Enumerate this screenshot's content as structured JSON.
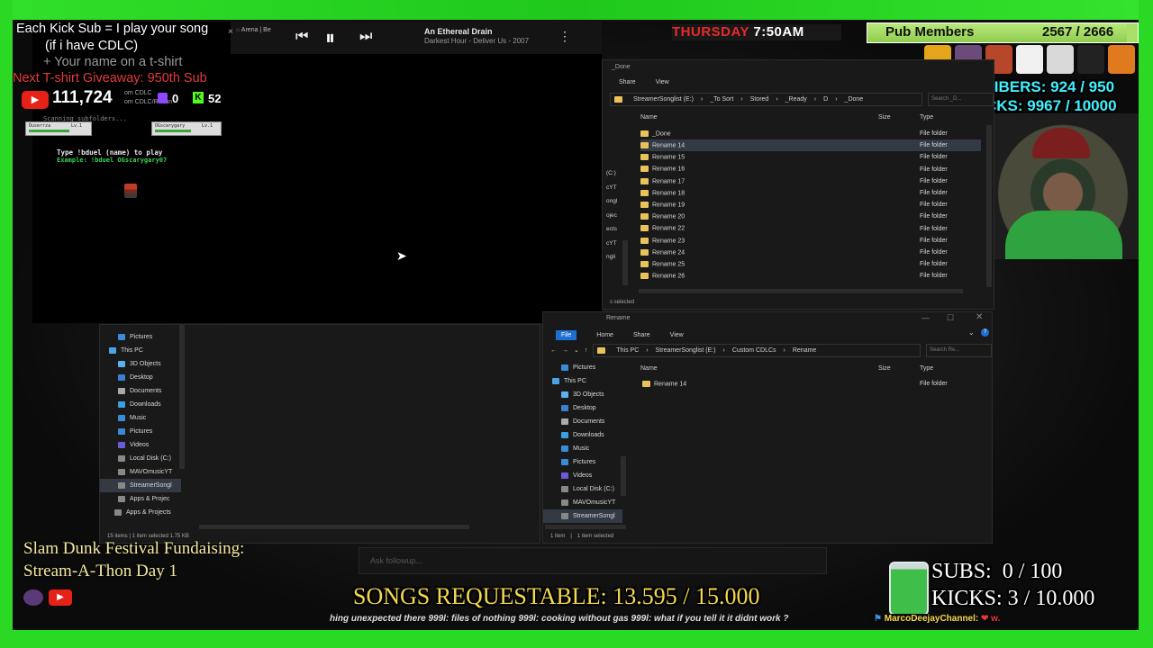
{
  "overlay": {
    "kick_sub_line": "Each Kick Sub = I play your song",
    "cdlc_line": "(if i have CDLC)",
    "tshirt_line": "+ Your name on a t-shirt",
    "giveaway_line": "Next T-shirt Giveaway: 950th Sub",
    "youtube_count": "111,724",
    "twitch_count": "0",
    "kick_count": "52",
    "day": "THURSDAY",
    "time": "7:50AM",
    "pub_label": "Pub Members",
    "pub_count": "2567 / 2666",
    "subscribers": "SUBSCRIBERS: 924 / 950",
    "kicks": "KICKS: 9967 / 10000",
    "fundraiser_line1": "Slam Dunk Festival Fundaising:",
    "fundraiser_line2": "Stream-A-Thon Day 1",
    "songs_requestable": "SONGS REQUESTABLE: 13.595 / 15.000",
    "goal_subs": "SUBS:  0 / 100",
    "goal_kicks": "KICKS: 3 / 10.000",
    "ticker": "hing unexpected there  999l: files of nothing  999l: cooking without gas  999l: what if you tell it it didnt work ?",
    "ticker_channel": "MarcoDeejayChannel:",
    "ask_followup": "Ask followup..."
  },
  "player": {
    "tab_label": "Arena | Be",
    "song_title": "An Ethereal Drain",
    "song_artist": "Darkest Hour - Deliver Us - 2007"
  },
  "game": {
    "scanning": "Scanning subfolders...",
    "player1": "Duserrza",
    "player2": "OGscarygary",
    "player1_level": "Lv.1",
    "player2_level": "Lv.1",
    "instruction": "Type !bduel (name) to play",
    "example": "Example: !bduel OGscarygary07",
    "partial_cdlc_1": "om CDLC",
    "partial_cdlc_2": "om CDLC/Rename"
  },
  "explorer_top": {
    "window_title": "_Done",
    "tabs": [
      "Share",
      "View"
    ],
    "breadcrumb": [
      "StreamerSonglist (E:)",
      "_To Sort",
      "Stored",
      "_Ready",
      "D",
      "_Done"
    ],
    "search_placeholder": "Search _D...",
    "columns": {
      "name": "Name",
      "size": "Size",
      "type": "Type"
    },
    "nav_partial": [
      "(C:)",
      "cYT",
      "ongl",
      "ojec",
      "ects",
      "cYT",
      "ngli"
    ],
    "rows": [
      {
        "name": "_Done",
        "type": "File folder"
      },
      {
        "name": "Rename 14",
        "type": "File folder"
      },
      {
        "name": "Rename 15",
        "type": "File folder"
      },
      {
        "name": "Rename 16",
        "type": "File folder"
      },
      {
        "name": "Rename 17",
        "type": "File folder"
      },
      {
        "name": "Rename 18",
        "type": "File folder"
      },
      {
        "name": "Rename 19",
        "type": "File folder"
      },
      {
        "name": "Rename 20",
        "type": "File folder"
      },
      {
        "name": "Rename 22",
        "type": "File folder"
      },
      {
        "name": "Rename 23",
        "type": "File folder"
      },
      {
        "name": "Rename 24",
        "type": "File folder"
      },
      {
        "name": "Rename 25",
        "type": "File folder"
      },
      {
        "name": "Rename 26",
        "type": "File folder"
      }
    ],
    "status": "s selected"
  },
  "explorer_bottom": {
    "window_title": "Rename",
    "tabs": [
      "File",
      "Home",
      "Share",
      "View"
    ],
    "breadcrumb": [
      "This PC",
      "StreamerSonglist (E:)",
      "Custom CDLCs",
      "Rename"
    ],
    "search_placeholder": "Search Re...",
    "columns": {
      "name": "Name",
      "size": "Size",
      "type": "Type"
    },
    "nav": [
      "Pictures",
      "This PC",
      "3D Objects",
      "Desktop",
      "Documents",
      "Downloads",
      "Music",
      "Pictures",
      "Videos",
      "Local Disk (C:)",
      "MAVOmusicYT",
      "StreamerSongl"
    ],
    "rows": [
      {
        "name": "Rename 14",
        "type": "File folder"
      }
    ],
    "status_items": "1 item",
    "status_selected": "1 item selected"
  },
  "explorer_left": {
    "nav": [
      "Pictures",
      "This PC",
      "3D Objects",
      "Desktop",
      "Documents",
      "Downloads",
      "Music",
      "Pictures",
      "Videos",
      "Local Disk (C:)",
      "MAVOmusicYT",
      "StreamerSongl",
      "Apps & Projec",
      "Apps & Projects"
    ],
    "status": "15 items  |  1 item selected  1.75 KB"
  }
}
